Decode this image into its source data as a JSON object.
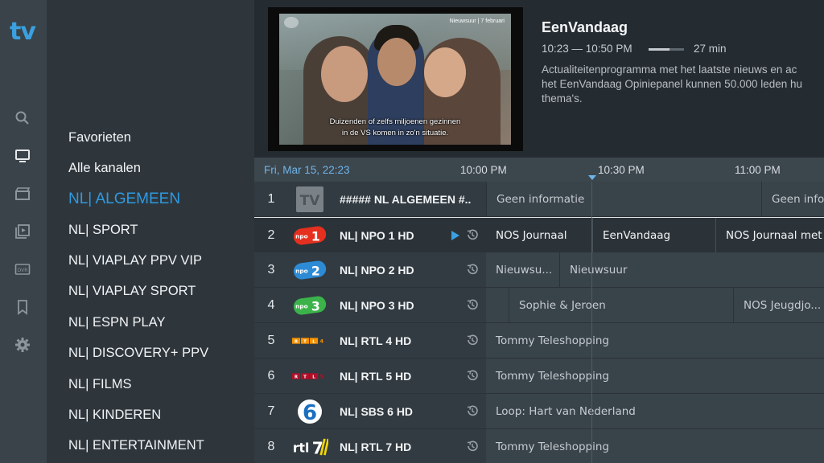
{
  "app": {
    "logo": "tv"
  },
  "rail": {
    "icons": [
      "search-icon",
      "tv-icon",
      "movies-icon",
      "series-icon",
      "dvr-icon",
      "bookmark-icon",
      "gear-icon"
    ],
    "dvr_label": "DVR"
  },
  "categories": {
    "items": [
      {
        "label": "Favorieten"
      },
      {
        "label": "Alle kanalen"
      },
      {
        "label": "NL| ALGEMEEN"
      },
      {
        "label": "NL| SPORT"
      },
      {
        "label": "NL| VIAPLAY PPV VIP"
      },
      {
        "label": "NL| VIAPLAY SPORT"
      },
      {
        "label": "NL| ESPN PLAY"
      },
      {
        "label": "NL| DISCOVERY+ PPV"
      },
      {
        "label": "NL| FILMS"
      },
      {
        "label": "NL| KINDEREN"
      },
      {
        "label": "NL| ENTERTAINMENT"
      }
    ],
    "active": "NL| ALGEMEEN"
  },
  "preview": {
    "video_tag": "Nieuwsuur | 7 februari",
    "subtitle_line1": "Duizenden of zelfs miljoenen gezinnen",
    "subtitle_line2": "in de VS komen in zo'n situatie.",
    "title": "EenVandaag",
    "time": "10:23 — 10:50 PM",
    "progress": 0.6,
    "duration": "27 min",
    "description_line1": "Actualiteitenprogramma met het laatste nieuws en ac",
    "description_line2": "het EenVandaag Opiniepanel kunnen 50.000 leden hu",
    "description_line3": "thema's."
  },
  "timeline": {
    "date": "Fri, Mar 15, 22:23",
    "hours": [
      "10:00 PM",
      "10:30 PM",
      "11:00 PM"
    ]
  },
  "channels": [
    {
      "number": "1",
      "name": "##### NL ALGEMEEN #..",
      "logo": "tv-placeholder-logo",
      "programs": [
        "Geen informatie",
        "Geen infor"
      ]
    },
    {
      "number": "2",
      "name": "NL| NPO 1 HD",
      "logo": "npo1-logo",
      "playing": true,
      "programs": [
        "NOS Journaal",
        "EenVandaag",
        "NOS Journaal met g"
      ]
    },
    {
      "number": "3",
      "name": "NL| NPO 2 HD",
      "logo": "npo2-logo",
      "programs": [
        "Nieuwsu...",
        "Nieuwsuur"
      ]
    },
    {
      "number": "4",
      "name": "NL| NPO 3 HD",
      "logo": "npo3-logo",
      "programs": [
        "",
        "Sophie & Jeroen",
        "NOS Jeugdjo..."
      ]
    },
    {
      "number": "5",
      "name": "NL| RTL 4 HD",
      "logo": "rtl4-logo",
      "programs": [
        "Tommy Teleshopping"
      ]
    },
    {
      "number": "6",
      "name": "NL| RTL 5 HD",
      "logo": "rtl5-logo",
      "programs": [
        "Tommy Teleshopping"
      ]
    },
    {
      "number": "7",
      "name": "NL| SBS 6 HD",
      "logo": "sbs6-logo",
      "programs": [
        "Loop: Hart van Nederland"
      ]
    },
    {
      "number": "8",
      "name": "NL| RTL 7 HD",
      "logo": "rtl7-logo",
      "programs": [
        "Tommy Teleshopping"
      ]
    }
  ],
  "colors": {
    "accent": "#2f9ae0",
    "npo_red": "#e5301f",
    "npo_blue": "#2d8bd6",
    "npo_green": "#3bb34a"
  }
}
